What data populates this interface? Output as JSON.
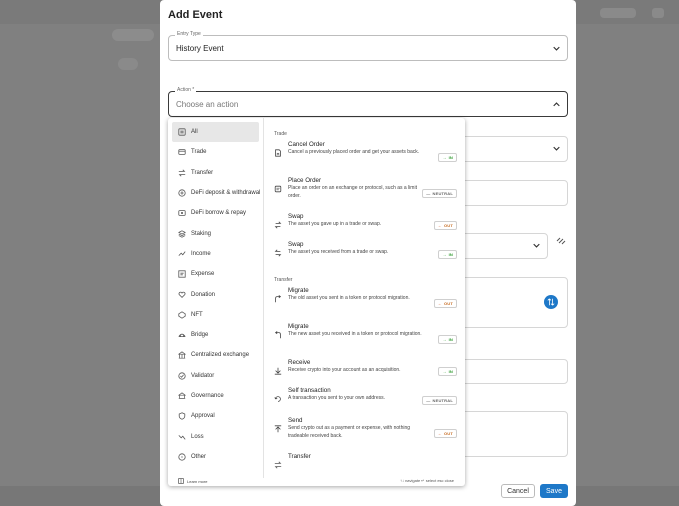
{
  "modal": {
    "title": "Add Event"
  },
  "entry_type": {
    "label": "Entry Type",
    "value": "History Event"
  },
  "action": {
    "label": "Action *",
    "placeholder": "Choose an action"
  },
  "categories": [
    {
      "label": "All",
      "icon": "list-icon",
      "active": true
    },
    {
      "label": "Trade",
      "icon": "trade-icon"
    },
    {
      "label": "Transfer",
      "icon": "transfer-icon"
    },
    {
      "label": "DeFi deposit & withdrawal",
      "icon": "defi-deposit-icon"
    },
    {
      "label": "DeFi borrow & repay",
      "icon": "defi-borrow-icon"
    },
    {
      "label": "Staking",
      "icon": "staking-icon"
    },
    {
      "label": "Income",
      "icon": "income-icon"
    },
    {
      "label": "Expense",
      "icon": "expense-icon"
    },
    {
      "label": "Donation",
      "icon": "donation-icon"
    },
    {
      "label": "NFT",
      "icon": "nft-icon"
    },
    {
      "label": "Bridge",
      "icon": "bridge-icon"
    },
    {
      "label": "Centralized exchange",
      "icon": "exchange-icon"
    },
    {
      "label": "Validator",
      "icon": "validator-icon"
    },
    {
      "label": "Governance",
      "icon": "governance-icon"
    },
    {
      "label": "Approval",
      "icon": "approval-icon"
    },
    {
      "label": "Loss",
      "icon": "loss-icon"
    },
    {
      "label": "Other",
      "icon": "other-icon"
    }
  ],
  "groups": {
    "trade": "Trade",
    "transfer": "Transfer"
  },
  "trade_events": [
    {
      "name": "Cancel Order",
      "desc": "Cancel a previously placed order and get your assets back.",
      "badge": "IN",
      "kind": "in",
      "icon": "cancel-order-icon"
    },
    {
      "name": "Place Order",
      "desc": "Place an order on an exchange or protocol, such as a limit order.",
      "badge": "NEUTRAL",
      "kind": "neutral",
      "icon": "place-order-icon"
    },
    {
      "name": "Swap",
      "desc": "The asset you gave up in a trade or swap.",
      "badge": "OUT",
      "kind": "out",
      "icon": "swap-out-icon"
    },
    {
      "name": "Swap",
      "desc": "The asset you received from a trade or swap.",
      "badge": "IN",
      "kind": "in",
      "icon": "swap-in-icon"
    }
  ],
  "transfer_events": [
    {
      "name": "Migrate",
      "desc": "The old asset you sent in a token or protocol migration.",
      "badge": "OUT",
      "kind": "out",
      "icon": "migrate-out-icon"
    },
    {
      "name": "Migrate",
      "desc": "The new asset you received in a token or protocol migration.",
      "badge": "IN",
      "kind": "in",
      "icon": "migrate-in-icon"
    },
    {
      "name": "Receive",
      "desc": "Receive crypto into your account as an acquisition.",
      "badge": "IN",
      "kind": "in",
      "icon": "receive-icon"
    },
    {
      "name": "Self transaction",
      "desc": "A transaction you sent to your own address.",
      "badge": "NEUTRAL",
      "kind": "neutral",
      "icon": "self-transaction-icon"
    },
    {
      "name": "Send",
      "desc": "Send crypto out as a payment or expense, with nothing tradeable received back.",
      "badge": "OUT",
      "kind": "out",
      "icon": "send-icon"
    },
    {
      "name": "Transfer",
      "desc": "",
      "badge": "",
      "kind": "neutral",
      "icon": "transfer-icon"
    }
  ],
  "dropdown_footer": {
    "learn_more": "Learn more",
    "keys": "↑↓ navigate  ↵ select  esc close"
  },
  "buttons": {
    "cancel": "Cancel",
    "save": "Save"
  },
  "colors": {
    "primary": "#1e78c8",
    "in": "#2e9a2e",
    "out": "#c66a1f"
  }
}
